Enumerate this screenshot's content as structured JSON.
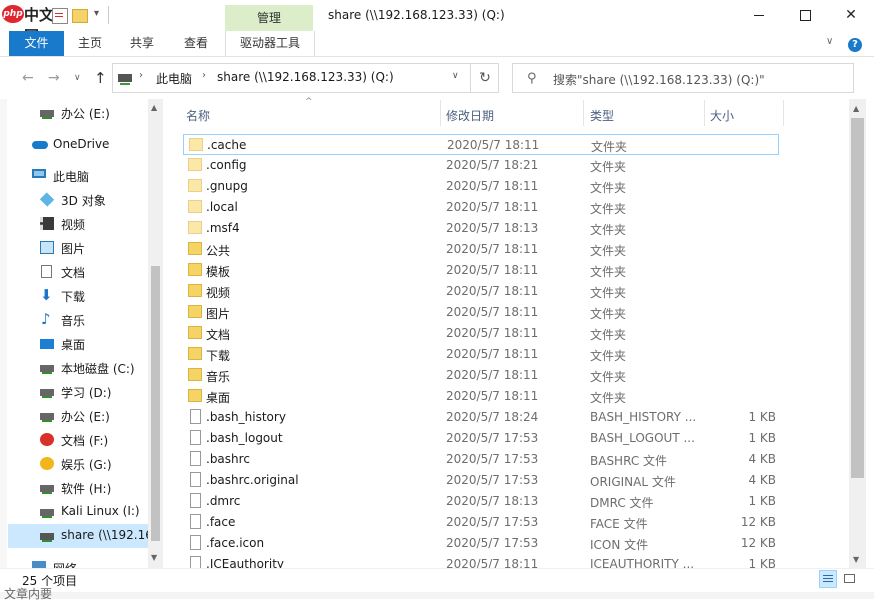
{
  "app": {
    "logo_text": "中文网",
    "logo_badge": "php",
    "window_title": "share (\\\\192.168.123.33) (Q:)",
    "manage_label": "管理"
  },
  "ribbon": {
    "tabs": [
      "文件",
      "主页",
      "共享",
      "查看",
      "驱动器工具"
    ],
    "help": "?"
  },
  "address": {
    "crumbs": [
      "此电脑",
      "share (\\\\192.168.123.33) (Q:)"
    ],
    "search_placeholder": "搜索\"share (\\\\192.168.123.33) (Q:)\""
  },
  "sidebar": {
    "items": [
      {
        "label": "办公 (E:)",
        "icon": "drive-icon"
      },
      {
        "label": "OneDrive",
        "icon": "onedrive-icon"
      },
      {
        "label": "此电脑",
        "icon": "computer-icon"
      },
      {
        "label": "3D 对象",
        "icon": "3d-objects-icon"
      },
      {
        "label": "视频",
        "icon": "video-icon"
      },
      {
        "label": "图片",
        "icon": "pictures-icon"
      },
      {
        "label": "文档",
        "icon": "documents-icon"
      },
      {
        "label": "下载",
        "icon": "download-icon"
      },
      {
        "label": "音乐",
        "icon": "music-icon"
      },
      {
        "label": "桌面",
        "icon": "desktop-icon"
      },
      {
        "label": "本地磁盘 (C:)",
        "icon": "drive-icon"
      },
      {
        "label": "学习 (D:)",
        "icon": "drive-icon"
      },
      {
        "label": "办公 (E:)",
        "icon": "drive-icon"
      },
      {
        "label": "文档 (F:)",
        "icon": "wps-drive-icon"
      },
      {
        "label": "娱乐 (G:)",
        "icon": "entertainment-drive-icon"
      },
      {
        "label": "软件 (H:)",
        "icon": "drive-icon"
      },
      {
        "label": "Kali Linux (I:)",
        "icon": "drive-icon"
      },
      {
        "label": "share (\\\\192.16",
        "icon": "network-drive-icon"
      },
      {
        "label": "网络",
        "icon": "network-icon"
      }
    ]
  },
  "columns": {
    "name": "名称",
    "date": "修改日期",
    "type": "类型",
    "size": "大小"
  },
  "files": [
    {
      "name": ".cache",
      "date": "2020/5/7 18:11",
      "type": "文件夹",
      "size": "",
      "kind": "folder-light"
    },
    {
      "name": ".config",
      "date": "2020/5/7 18:21",
      "type": "文件夹",
      "size": "",
      "kind": "folder-light"
    },
    {
      "name": ".gnupg",
      "date": "2020/5/7 18:11",
      "type": "文件夹",
      "size": "",
      "kind": "folder-light"
    },
    {
      "name": ".local",
      "date": "2020/5/7 18:11",
      "type": "文件夹",
      "size": "",
      "kind": "folder-light"
    },
    {
      "name": ".msf4",
      "date": "2020/5/7 18:13",
      "type": "文件夹",
      "size": "",
      "kind": "folder-light"
    },
    {
      "name": "公共",
      "date": "2020/5/7 18:11",
      "type": "文件夹",
      "size": "",
      "kind": "folder"
    },
    {
      "name": "模板",
      "date": "2020/5/7 18:11",
      "type": "文件夹",
      "size": "",
      "kind": "folder"
    },
    {
      "name": "视频",
      "date": "2020/5/7 18:11",
      "type": "文件夹",
      "size": "",
      "kind": "folder"
    },
    {
      "name": "图片",
      "date": "2020/5/7 18:11",
      "type": "文件夹",
      "size": "",
      "kind": "folder"
    },
    {
      "name": "文档",
      "date": "2020/5/7 18:11",
      "type": "文件夹",
      "size": "",
      "kind": "folder"
    },
    {
      "name": "下载",
      "date": "2020/5/7 18:11",
      "type": "文件夹",
      "size": "",
      "kind": "folder"
    },
    {
      "name": "音乐",
      "date": "2020/5/7 18:11",
      "type": "文件夹",
      "size": "",
      "kind": "folder"
    },
    {
      "name": "桌面",
      "date": "2020/5/7 18:11",
      "type": "文件夹",
      "size": "",
      "kind": "folder"
    },
    {
      "name": ".bash_history",
      "date": "2020/5/7 18:24",
      "type": "BASH_HISTORY ...",
      "size": "1 KB",
      "kind": "file"
    },
    {
      "name": ".bash_logout",
      "date": "2020/5/7 17:53",
      "type": "BASH_LOGOUT ...",
      "size": "1 KB",
      "kind": "file"
    },
    {
      "name": ".bashrc",
      "date": "2020/5/7 17:53",
      "type": "BASHRC 文件",
      "size": "4 KB",
      "kind": "file"
    },
    {
      "name": ".bashrc.original",
      "date": "2020/5/7 17:53",
      "type": "ORIGINAL 文件",
      "size": "4 KB",
      "kind": "file"
    },
    {
      "name": ".dmrc",
      "date": "2020/5/7 18:13",
      "type": "DMRC 文件",
      "size": "1 KB",
      "kind": "file"
    },
    {
      "name": ".face",
      "date": "2020/5/7 17:53",
      "type": "FACE 文件",
      "size": "12 KB",
      "kind": "file"
    },
    {
      "name": ".face.icon",
      "date": "2020/5/7 17:53",
      "type": "ICON 文件",
      "size": "12 KB",
      "kind": "file"
    },
    {
      "name": ".ICEauthority",
      "date": "2020/5/7 18:11",
      "type": "ICEAUTHORITY ...",
      "size": "1 KB",
      "kind": "file"
    }
  ],
  "status": {
    "count": "25 个项目"
  },
  "background": {
    "bottom_text": "文章内要"
  }
}
